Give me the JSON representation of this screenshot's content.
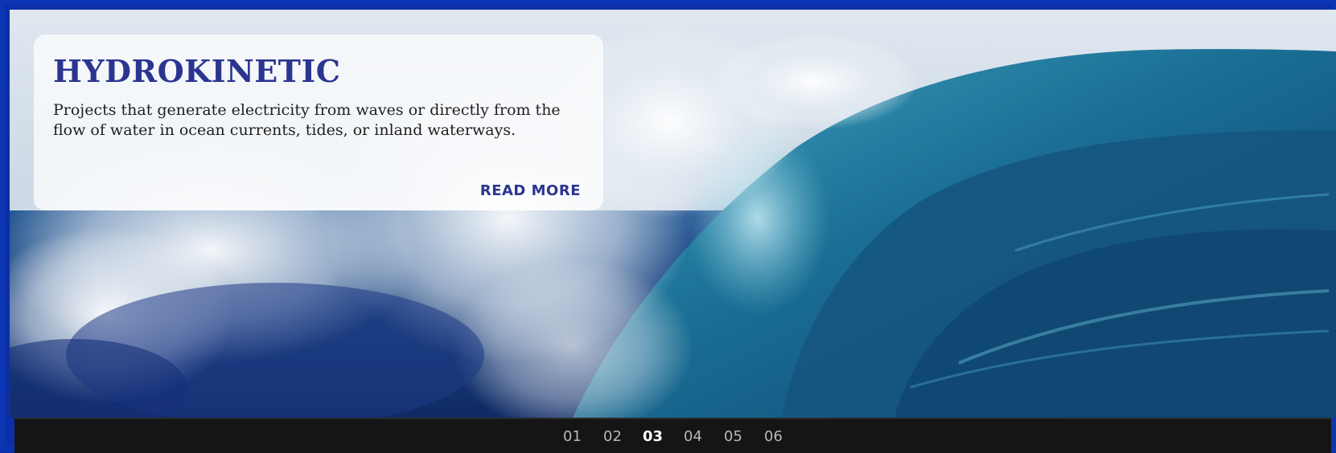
{
  "slide": {
    "title": "HYDROKINETIC",
    "description": "Projects that generate electricity from waves or directly from the flow of water in ocean currents, tides, or inland waterways.",
    "read_more_label": "READ MORE"
  },
  "pager": {
    "pages": [
      "01",
      "02",
      "03",
      "04",
      "05",
      "06"
    ],
    "active_page": "03"
  },
  "colors": {
    "frame_border": "#0b35b3",
    "title": "#2b3590",
    "pager_background": "#151515"
  }
}
